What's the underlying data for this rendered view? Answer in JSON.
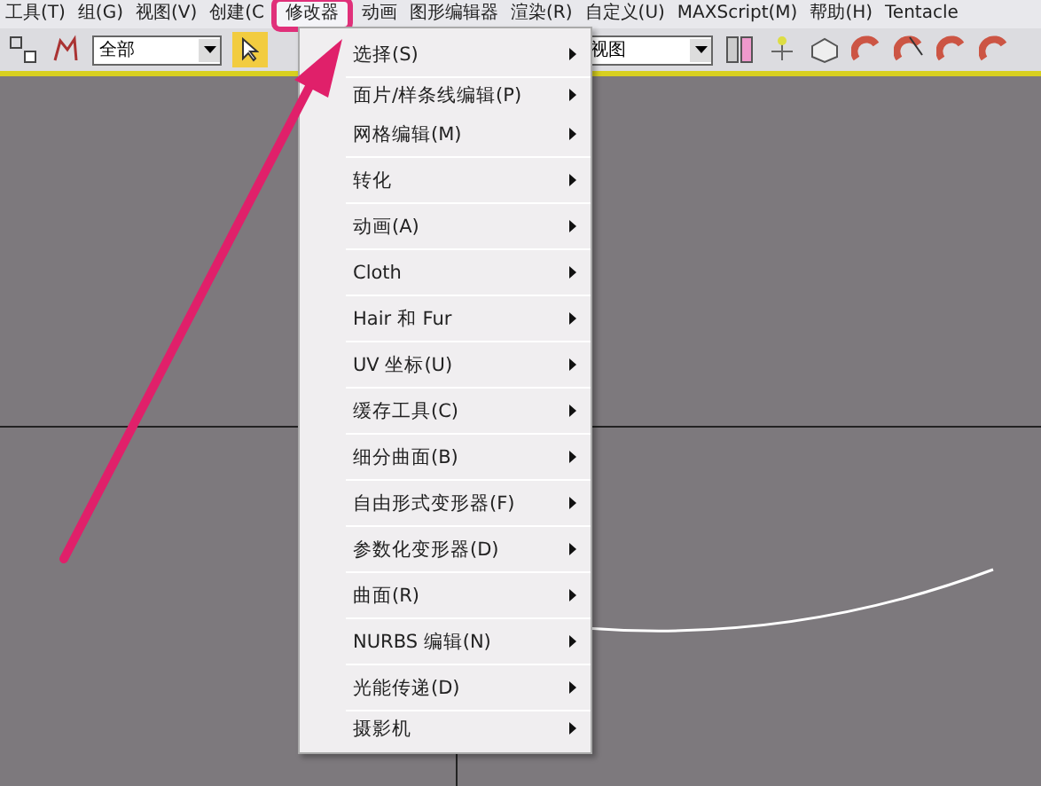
{
  "menu_bar": [
    {
      "label": "工具(T)",
      "selected": false
    },
    {
      "label": "组(G)",
      "selected": false
    },
    {
      "label": "视图(V)",
      "selected": false
    },
    {
      "label": "创建(C",
      "selected": false
    },
    {
      "label": "修改器",
      "selected": true
    },
    {
      "label": "动画",
      "selected": false
    },
    {
      "label": "图形编辑器",
      "selected": false
    },
    {
      "label": "渲染(R)",
      "selected": false
    },
    {
      "label": "自定义(U)",
      "selected": false
    },
    {
      "label": "MAXScript(M)",
      "selected": false
    },
    {
      "label": "帮助(H)",
      "selected": false
    },
    {
      "label": "Tentacle",
      "selected": false
    }
  ],
  "toolbar": {
    "selection_filter": "全部",
    "view_dropdown": "视图"
  },
  "dropdown_menu": [
    {
      "label": "选择(S)",
      "separator_after": true
    },
    {
      "label": "面片/样条线编辑(P)",
      "separator_after": false
    },
    {
      "label": "网格编辑(M)",
      "separator_after": true
    },
    {
      "label": "转化",
      "separator_after": true
    },
    {
      "label": "动画(A)",
      "separator_after": true
    },
    {
      "label": "Cloth",
      "separator_after": true
    },
    {
      "label": "Hair 和 Fur",
      "separator_after": true
    },
    {
      "label": "UV 坐标(U)",
      "separator_after": true
    },
    {
      "label": "缓存工具(C)",
      "separator_after": true
    },
    {
      "label": "细分曲面(B)",
      "separator_after": true
    },
    {
      "label": "自由形式变形器(F)",
      "separator_after": true
    },
    {
      "label": "参数化变形器(D)",
      "separator_after": true
    },
    {
      "label": "曲面(R)",
      "separator_after": true
    },
    {
      "label": "NURBS 编辑(N)",
      "separator_after": true
    },
    {
      "label": "光能传递(D)",
      "separator_after": true
    },
    {
      "label": "摄影机",
      "separator_after": false
    }
  ]
}
